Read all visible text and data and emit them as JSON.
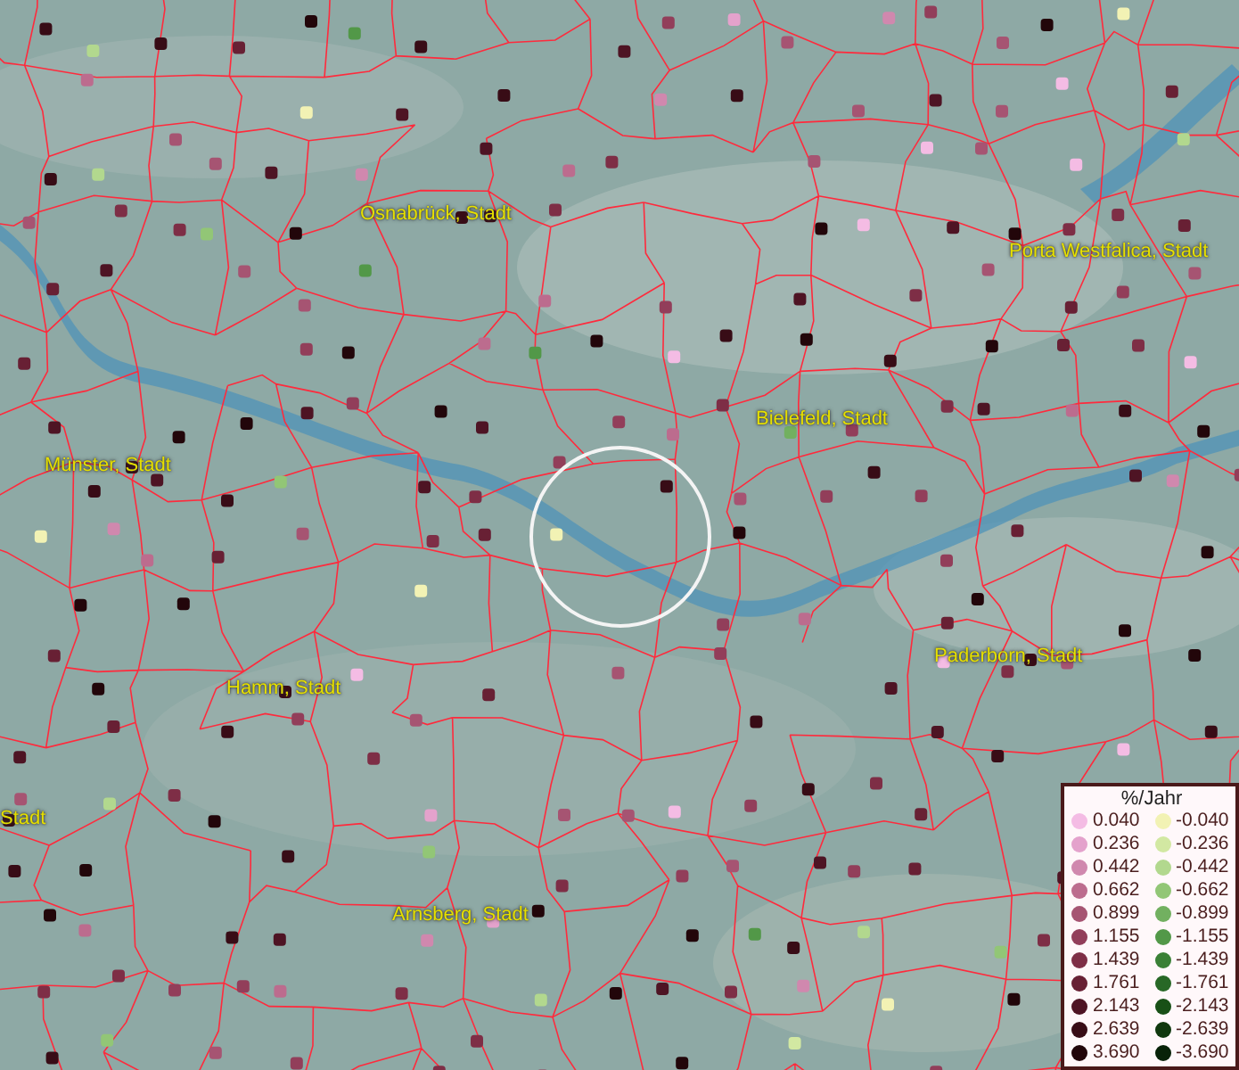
{
  "map": {
    "places": [
      {
        "name": "Osnabrück, Stadt"
      },
      {
        "name": "Porta Westfalica, Stadt"
      },
      {
        "name": "Bielefeld, Stadt"
      },
      {
        "name": "Münster, Stadt"
      },
      {
        "name": "Paderborn, Stadt"
      },
      {
        "name": "Hamm, Stadt"
      },
      {
        "name": "Stadt"
      },
      {
        "name": "Arnsberg, Stadt"
      }
    ]
  },
  "legend": {
    "title": "%/Jahr",
    "positive": [
      {
        "label": "0.040",
        "color": "#f4bce4"
      },
      {
        "label": "0.236",
        "color": "#e4a2cc"
      },
      {
        "label": "0.442",
        "color": "#d088ae"
      },
      {
        "label": "0.662",
        "color": "#bc6c8e"
      },
      {
        "label": "0.899",
        "color": "#a65472"
      },
      {
        "label": "1.155",
        "color": "#923e5a"
      },
      {
        "label": "1.439",
        "color": "#7e2e46"
      },
      {
        "label": "1.761",
        "color": "#682034"
      },
      {
        "label": "2.143",
        "color": "#4e1424"
      },
      {
        "label": "2.639",
        "color": "#380c16"
      },
      {
        "label": "3.690",
        "color": "#22060a"
      }
    ],
    "negative": [
      {
        "label": "-0.040",
        "color": "#f2f2b4"
      },
      {
        "label": "-0.236",
        "color": "#d2e8a2"
      },
      {
        "label": "-0.442",
        "color": "#b2d88e"
      },
      {
        "label": "-0.662",
        "color": "#92c676"
      },
      {
        "label": "-0.899",
        "color": "#72b060"
      },
      {
        "label": "-1.155",
        "color": "#529848"
      },
      {
        "label": "-1.439",
        "color": "#3a8036"
      },
      {
        "label": "-1.761",
        "color": "#286826"
      },
      {
        "label": "-2.143",
        "color": "#185016"
      },
      {
        "label": "-2.639",
        "color": "#10380e"
      },
      {
        "label": "-3.690",
        "color": "#082208"
      }
    ]
  }
}
